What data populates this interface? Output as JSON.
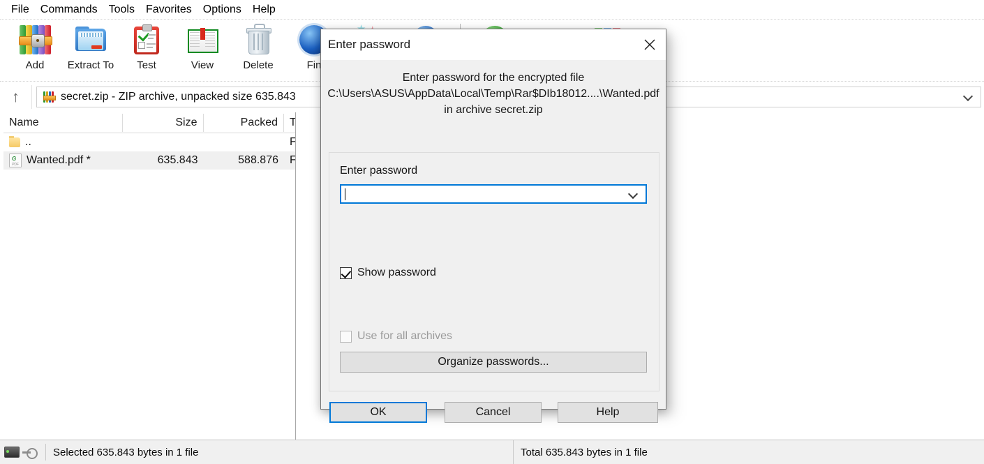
{
  "menu": {
    "items": [
      "File",
      "Commands",
      "Tools",
      "Favorites",
      "Options",
      "Help"
    ]
  },
  "toolbar": {
    "buttons": [
      {
        "label": "Add",
        "icon": "archive-books-icon"
      },
      {
        "label": "Extract To",
        "icon": "extract-folder-icon"
      },
      {
        "label": "Test",
        "icon": "clipboard-check-icon"
      },
      {
        "label": "View",
        "icon": "open-book-icon"
      },
      {
        "label": "Delete",
        "icon": "trash-can-icon"
      },
      {
        "label": "Fin",
        "icon": "find-orb-icon"
      }
    ]
  },
  "address": {
    "up_tooltip": "Up one level",
    "icon": "rar-archive-icon",
    "text": "secret.zip - ZIP archive, unpacked size 635.843",
    "dropdown_icon": "chevron-down-icon"
  },
  "filelist": {
    "columns": [
      "Name",
      "Size",
      "Packed",
      "Typ"
    ],
    "rows": [
      {
        "name": "..",
        "size": "",
        "packed": "",
        "type": "File",
        "icon": "folder-icon",
        "selected": false
      },
      {
        "name": "Wanted.pdf *",
        "size": "635.843",
        "packed": "588.876",
        "type": "Foxi",
        "icon": "pdf-file-icon",
        "selected": true
      }
    ]
  },
  "statusbar": {
    "drive_icon": "drive-icon",
    "key_icon": "key-icon",
    "selected_text": "Selected 635.843 bytes in 1 file",
    "total_text": "Total 635.843 bytes in 1 file"
  },
  "dialog": {
    "title": "Enter password",
    "close_icon": "close-icon",
    "message_lines": [
      "Enter password for the encrypted file",
      "C:\\Users\\ASUS\\AppData\\Local\\Temp\\Rar$DIb18012....\\Wanted.pdf",
      "in archive secret.zip"
    ],
    "password_label": "Enter password",
    "password_value": "",
    "password_placeholder": "",
    "password_dropdown_icon": "chevron-down-icon",
    "show_password": {
      "label": "Show password",
      "checked": true
    },
    "use_for_all": {
      "label": "Use for all archives",
      "checked": false,
      "disabled": true
    },
    "organize_button": "Organize passwords...",
    "ok_button": "OK",
    "cancel_button": "Cancel",
    "help_button": "Help"
  },
  "colors": {
    "accent": "#0078d7",
    "dialog_bg": "#f0f0f0",
    "button_bg": "#e1e1e1",
    "selection_bg": "#f0f0f0"
  }
}
